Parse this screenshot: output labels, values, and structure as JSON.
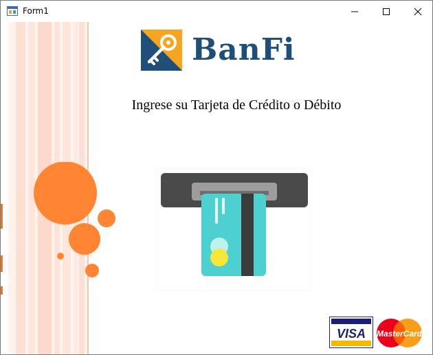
{
  "window": {
    "title": "Form1",
    "icons": {
      "app": "form-app-icon",
      "minimize": "minimize-icon",
      "maximize": "maximize-icon",
      "close": "close-icon"
    }
  },
  "header": {
    "brand_name": "BanFi",
    "logo_icon": "key-icon"
  },
  "main": {
    "instruction": "Ingrese su Tarjeta de Crédito  o Débito",
    "illustration_icon": "card-insert-icon"
  },
  "payment_logos": {
    "visa": "VISA",
    "mastercard": "MasterCard"
  },
  "colors": {
    "brand_text": "#1e4f78",
    "logo_blue": "#1f4e79",
    "logo_orange": "#f4a623",
    "decor_orange": "#ff8533",
    "stripe_pink": "#fde3d8",
    "card_teal": "#4dd0cf",
    "atm_gray": "#4a4a4a",
    "visa_blue": "#1a1f71",
    "mc_red": "#eb001b",
    "mc_orange": "#f79e1b"
  }
}
